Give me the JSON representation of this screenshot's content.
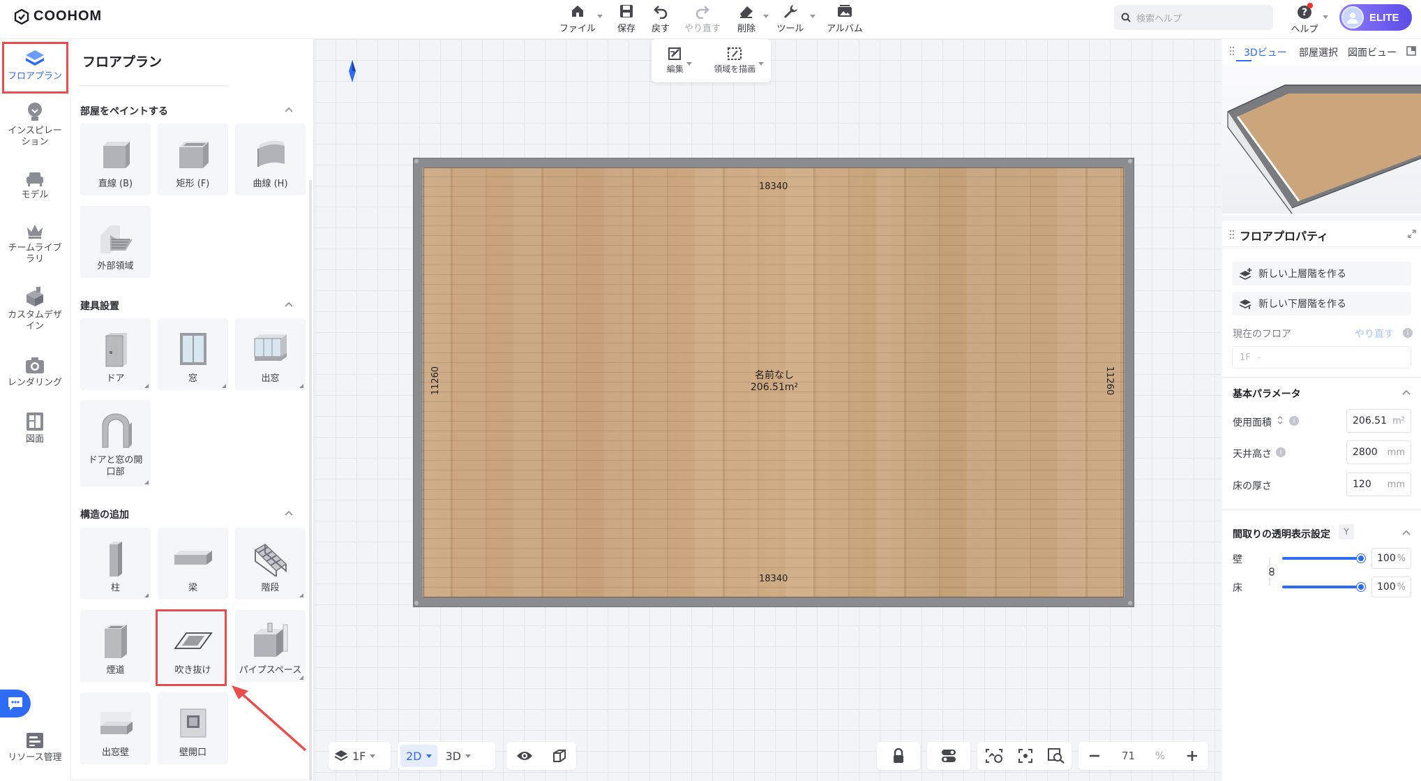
{
  "app": {
    "logo_text": "COOHOM"
  },
  "toolbar": {
    "file": "ファイル",
    "save": "保存",
    "undo": "戻す",
    "redo": "やり直す",
    "delete": "削除",
    "tools": "ツール",
    "album": "アルバム"
  },
  "search": {
    "placeholder": "検索ヘルプ"
  },
  "help": {
    "label": "ヘルプ"
  },
  "account": {
    "badge": "ELITE"
  },
  "rail": [
    {
      "label": "フロアプラン",
      "icon": "floorplan-icon",
      "active": true
    },
    {
      "label": "インスピレーション",
      "icon": "lightbulb-icon"
    },
    {
      "label": "モデル",
      "icon": "sofa-icon"
    },
    {
      "label": "チームライブラリ",
      "icon": "crown-icon"
    },
    {
      "label": "カスタムデザイン",
      "icon": "box-icon"
    },
    {
      "label": "レンダリング",
      "icon": "camera-icon"
    },
    {
      "label": "図面",
      "icon": "drawing-icon"
    },
    {
      "label": "リソース管理",
      "icon": "resource-icon"
    }
  ],
  "panel": {
    "title": "フロアプラン",
    "sections": {
      "paint": {
        "title": "部屋をペイントする",
        "items": [
          "直線 (B)",
          "矩形 (F)",
          "曲線 (H)",
          "外部領域"
        ]
      },
      "fixtures": {
        "title": "建具設置",
        "items": [
          "ドア",
          "窓",
          "出窓",
          "ドアと窓の開口部"
        ]
      },
      "structure": {
        "title": "構造の追加",
        "items": [
          "柱",
          "梁",
          "階段",
          "煙道",
          "吹き抜け",
          "パイプスペース",
          "出窓壁",
          "壁開口"
        ]
      }
    }
  },
  "canvas_toolbar": {
    "edit": "編集",
    "draw_area": "領域を描画"
  },
  "room": {
    "name": "名前なし",
    "area": "206.51m²",
    "width_top": "18340",
    "width_bottom": "18340",
    "height_left": "11260",
    "height_right": "11260"
  },
  "bottom": {
    "floor": "1F",
    "mode_2d": "2D",
    "mode_3d": "3D",
    "zoom": "71",
    "zoom_unit": "%"
  },
  "right": {
    "tabs": [
      "3Dビュー",
      "部屋選択",
      "図面ビュー"
    ],
    "props_title": "フロアプロパティ",
    "new_upper": "新しい上層階を作る",
    "new_lower": "新しい下層階を作る",
    "current_floor_label": "現在のフロア",
    "redo_link": "やり直す",
    "floor_value": "1F",
    "basic_params": "基本パラメータ",
    "usable_area_label": "使用面積",
    "usable_area_value": "206.51",
    "usable_area_unit": "m²",
    "ceiling_label": "天井高さ",
    "ceiling_value": "2800",
    "ceiling_unit": "mm",
    "floor_thickness_label": "床の厚さ",
    "floor_thickness_value": "120",
    "floor_thickness_unit": "mm",
    "transparency_title": "間取りの透明表示設定",
    "transparency_key": "Y",
    "wall_label": "壁",
    "wall_value": "100",
    "floor_label": "床",
    "floor_opacity_value": "100",
    "percent": "%"
  },
  "colors": {
    "accent": "#2f6cf6",
    "highlight": "#e84c4c",
    "elite_from": "#8f7bfb",
    "elite_to": "#5b4ce8"
  }
}
